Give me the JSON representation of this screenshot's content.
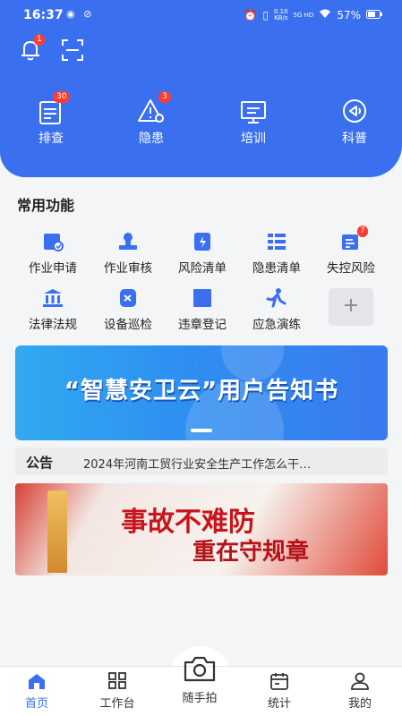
{
  "status_bar": {
    "time": "16:37",
    "net_speed": "0.10",
    "net_unit": "KB/s",
    "signal": "5G HD",
    "battery": "57%"
  },
  "header": {
    "notification_count": "1",
    "quick_items": [
      {
        "label": "排查",
        "badge": "30",
        "icon": "checklist-icon"
      },
      {
        "label": "隐患",
        "badge": "3",
        "icon": "warning-search-icon"
      },
      {
        "label": "培训",
        "badge": "",
        "icon": "presentation-icon"
      },
      {
        "label": "科普",
        "badge": "",
        "icon": "broadcast-icon"
      }
    ]
  },
  "common": {
    "title": "常用功能",
    "items": [
      {
        "label": "作业申请",
        "icon": "job-apply-icon",
        "badge": ""
      },
      {
        "label": "作业审核",
        "icon": "stamp-icon",
        "badge": ""
      },
      {
        "label": "风险清单",
        "icon": "risk-shield-icon",
        "badge": ""
      },
      {
        "label": "隐患清单",
        "icon": "list-icon",
        "badge": ""
      },
      {
        "label": "失控风险",
        "icon": "risk-report-icon",
        "badge": "7"
      },
      {
        "label": "法律法规",
        "icon": "courthouse-icon",
        "badge": ""
      },
      {
        "label": "设备巡检",
        "icon": "device-inspect-icon",
        "badge": ""
      },
      {
        "label": "违章登记",
        "icon": "violation-icon",
        "badge": ""
      },
      {
        "label": "应急演练",
        "icon": "emergency-drill-icon",
        "badge": ""
      }
    ],
    "add_label": "+"
  },
  "banner": {
    "text": "“智慧安卫云”用户告知书"
  },
  "notice": {
    "tag": "公告",
    "text": "2024年河南工贸行业安全生产工作怎么干…"
  },
  "poster": {
    "line1": "事故不难防",
    "line2": "重在守规章"
  },
  "tabbar": {
    "tabs": [
      {
        "label": "首页",
        "icon": "home-icon",
        "active": true
      },
      {
        "label": "工作台",
        "icon": "grid-icon",
        "active": false
      },
      {
        "label": "随手拍",
        "icon": "camera-icon",
        "active": false
      },
      {
        "label": "统计",
        "icon": "calendar-stats-icon",
        "active": false
      },
      {
        "label": "我的",
        "icon": "user-icon",
        "active": false
      }
    ]
  },
  "colors": {
    "primary": "#3a6ff0",
    "badge": "#ff3b30"
  }
}
